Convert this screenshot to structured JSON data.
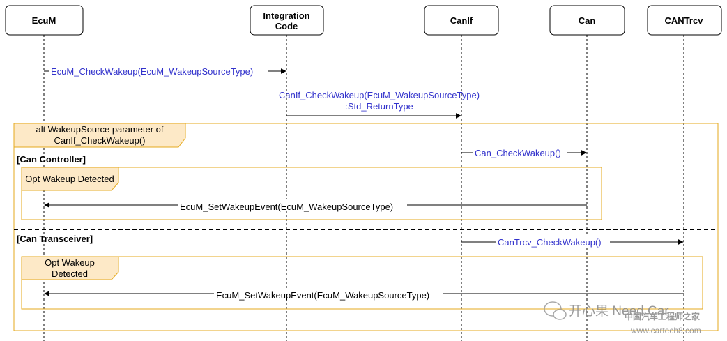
{
  "participants": [
    {
      "label_lines": [
        "EcuM"
      ]
    },
    {
      "label_lines": [
        "Integration",
        "Code"
      ]
    },
    {
      "label_lines": [
        "CanIf"
      ]
    },
    {
      "label_lines": [
        "Can"
      ]
    },
    {
      "label_lines": [
        "CANTrcv"
      ]
    }
  ],
  "messages": {
    "m1": "EcuM_CheckWakeup(EcuM_WakeupSourceType)",
    "m2_line1": "CanIf_CheckWakeup(EcuM_WakeupSourceType)",
    "m2_line2": ":Std_ReturnType",
    "m3": "Can_CheckWakeup()",
    "m4": "EcuM_SetWakeupEvent(EcuM_WakeupSourceType)",
    "m5": "CanTrcv_CheckWakeup()",
    "m6": "EcuM_SetWakeupEvent(EcuM_WakeupSourceType)"
  },
  "alt_frame": {
    "label_line1": "alt WakeupSource parameter of",
    "label_line2": "CanIf_CheckWakeup()",
    "guard1": "[Can Controller]",
    "guard2": "[Can Transceiver]"
  },
  "opt_frames": {
    "opt1_label": "Opt Wakeup Detected",
    "opt2_line1": "Opt Wakeup",
    "opt2_line2": "Detected"
  },
  "watermark": {
    "brand": "开心果 Need Car",
    "cn": "中国汽车工程师之家",
    "url": "www.cartech8.com"
  }
}
